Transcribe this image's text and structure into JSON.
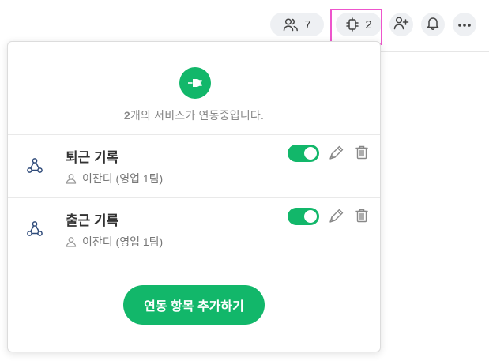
{
  "header": {
    "members_count": "7",
    "integrations_count": "2",
    "icons": {
      "members": "people-icon",
      "integrations": "plug-icon",
      "add_member": "add-user-icon",
      "notifications": "bell-icon",
      "more": "more-dots-icon"
    },
    "highlight_color": "#ee55cc"
  },
  "panel": {
    "summary_count": "2",
    "summary_text": "개의 서비스가 연동중입니다.",
    "accent_color": "#12b76a",
    "integrations": [
      {
        "title": "퇴근 기록",
        "owner": "이잔디 (영업 1팀)",
        "enabled": true,
        "icon": "webhook-icon"
      },
      {
        "title": "출근 기록",
        "owner": "이잔디 (영업 1팀)",
        "enabled": true,
        "icon": "webhook-icon"
      }
    ],
    "add_button_label": "연동 항목 추가하기"
  }
}
